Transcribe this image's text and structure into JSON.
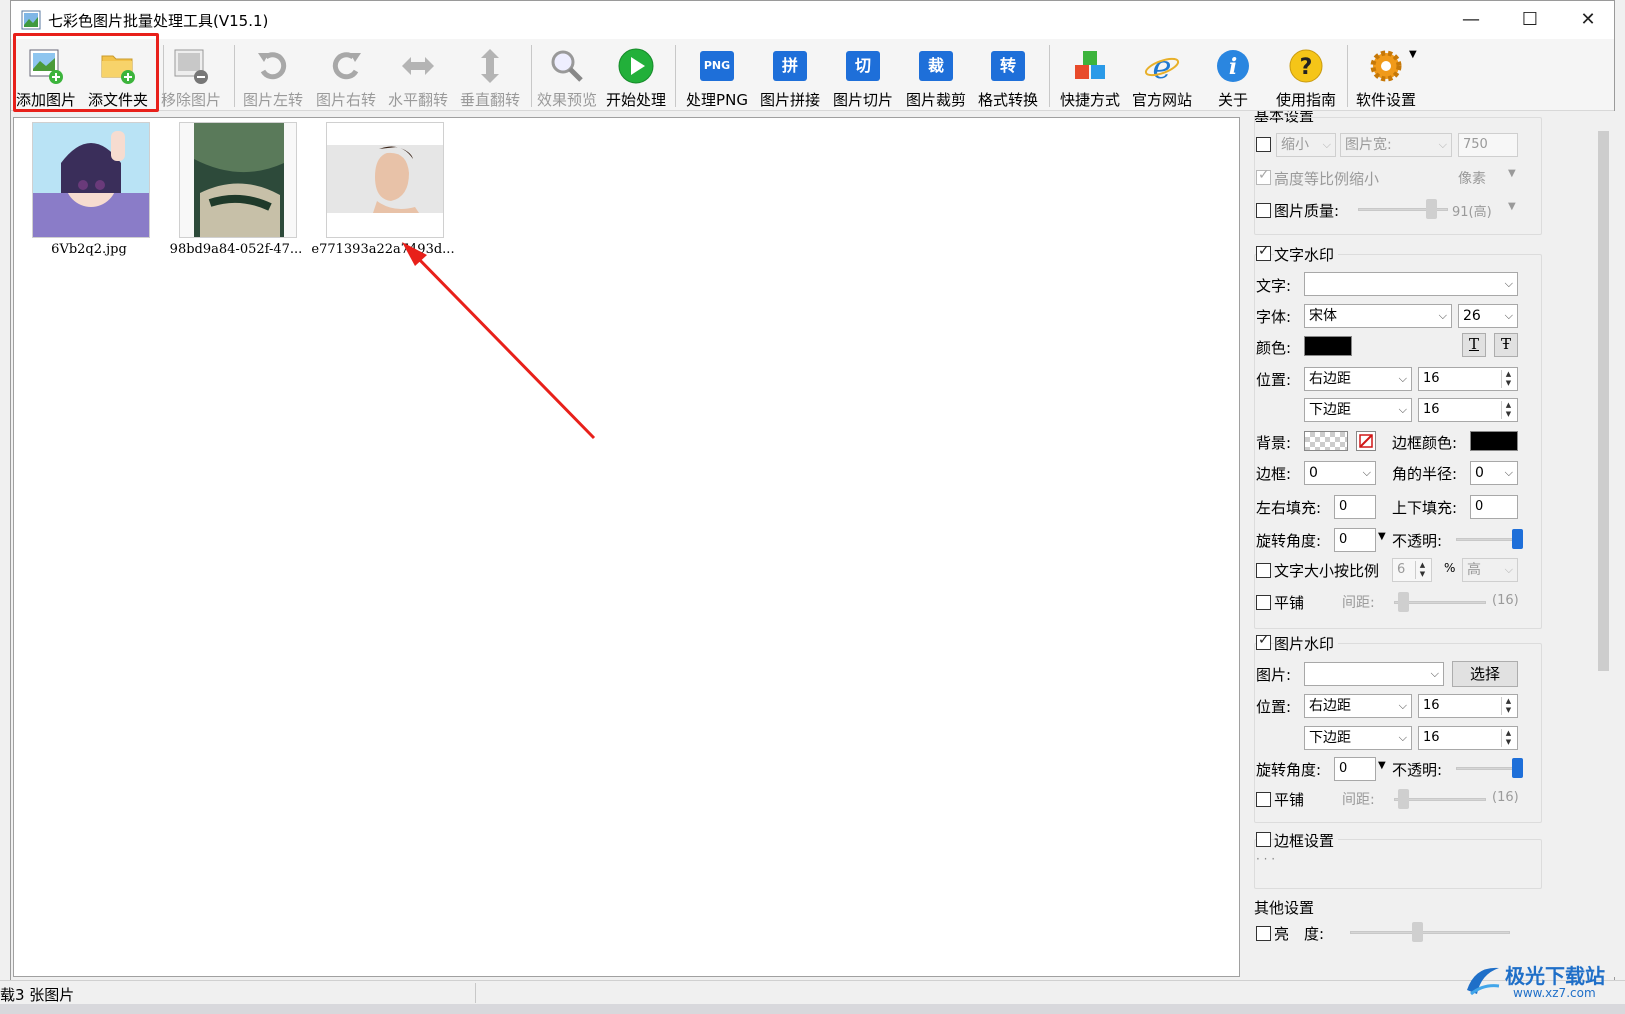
{
  "window": {
    "title": "七彩色图片批量处理工具(V15.1)",
    "min_glyph": "—",
    "max_glyph": "☐",
    "close_glyph": "✕"
  },
  "toolbar": {
    "add_image": "添加图片",
    "add_folder": "添文件夹",
    "remove_image": "移除图片",
    "rotate_left": "图片左转",
    "rotate_right": "图片右转",
    "flip_h": "水平翻转",
    "flip_v": "垂直翻转",
    "preview": "效果预览",
    "start": "开始处理",
    "process_png": "处理PNG",
    "png_badge": "PNG",
    "stitch": "图片拼接",
    "stitch_badge": "拼",
    "slice": "图片切片",
    "slice_badge": "切",
    "crop": "图片裁剪",
    "crop_badge": "裁",
    "convert": "格式转换",
    "convert_badge": "转",
    "shortcut": "快捷方式",
    "website": "官方网站",
    "about": "关于",
    "guide": "使用指南",
    "settings": "软件设置"
  },
  "files": [
    {
      "name": "6Vb2q2.jpg"
    },
    {
      "name": "98bd9a84-052f-47..."
    },
    {
      "name": "e771393a22a7493d..."
    }
  ],
  "basic": {
    "title": "基本设置",
    "shrink": "缩小",
    "width_mode": "图片宽:",
    "width_value": "750",
    "keep_ratio": "高度等比例缩小",
    "unit": "像素",
    "quality": "图片质量:",
    "quality_value": "91(高)"
  },
  "text_wm": {
    "title": "文字水印",
    "text_label": "文字:",
    "text_value": "",
    "font_label": "字体:",
    "font_value": "宋体",
    "size_value": "26",
    "color_label": "颜色:",
    "color": "#000000",
    "bold_glyph": "T",
    "strike_glyph": "Ŧ",
    "pos_label": "位置:",
    "pos_h": "右边距",
    "pos_h_value": "16",
    "pos_v": "下边距",
    "pos_v_value": "16",
    "bg_label": "背景:",
    "border_color_label": "边框颜色:",
    "border_color": "#000000",
    "border_label": "边框:",
    "border_value": "0",
    "radius_label": "角的半径:",
    "radius_value": "0",
    "pad_lr_label": "左右填充:",
    "pad_lr_value": "0",
    "pad_tb_label": "上下填充:",
    "pad_tb_value": "0",
    "rotate_label": "旋转角度:",
    "rotate_value": "0",
    "opacity_label": "不透明:",
    "opacity": 1.0,
    "scale_label": "文字大小按比例",
    "scale_value": "6",
    "percent": "%",
    "scale_level": "高",
    "tile_label": "平铺",
    "spacing_label": "间距:",
    "spacing_value": "(16)"
  },
  "image_wm": {
    "title": "图片水印",
    "image_label": "图片:",
    "image_value": "",
    "choose": "选择",
    "pos_label": "位置:",
    "pos_h": "右边距",
    "pos_h_value": "16",
    "pos_v": "下边距",
    "pos_v_value": "16",
    "rotate_label": "旋转角度:",
    "rotate_value": "0",
    "opacity_label": "不透明:",
    "opacity": 1.0,
    "tile_label": "平铺",
    "spacing_label": "间距:",
    "spacing_value": "(16)"
  },
  "border_set": {
    "title": "边框设置",
    "dots": "· · ·"
  },
  "other": {
    "title": "其他设置",
    "brightness": "亮　度:"
  },
  "status": {
    "text": "载3 张图片"
  },
  "watermark": {
    "brand": "极光下载站",
    "url": "www.xz7.com"
  },
  "colors": {
    "highlight": "#e8201a",
    "accent": "#1e6fd9"
  }
}
